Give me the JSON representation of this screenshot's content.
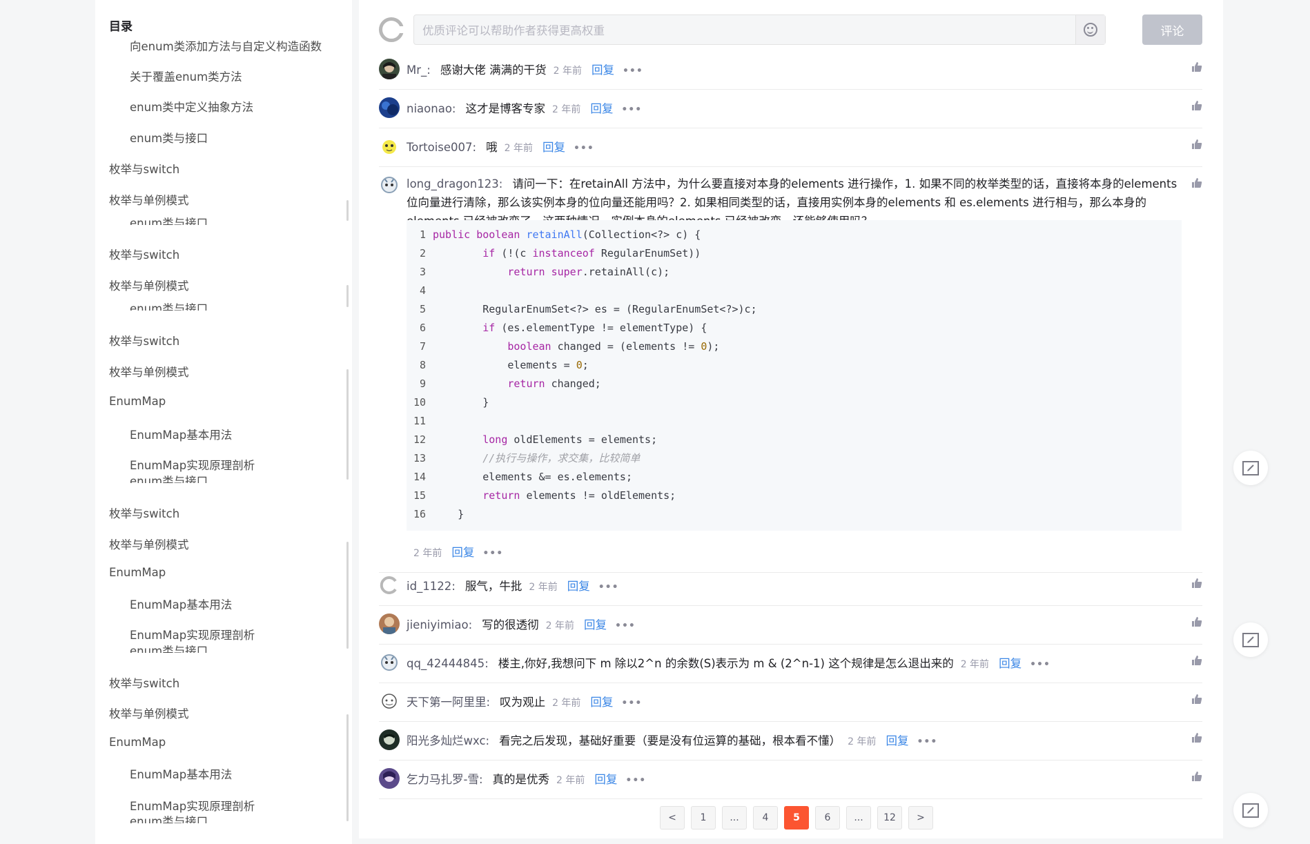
{
  "toc": {
    "title": "目录",
    "items": [
      {
        "label": "向enum类添加方法与自定义构造函数",
        "level": 2
      },
      {
        "label": "关于覆盖enum类方法",
        "level": 2
      },
      {
        "label": "enum类中定义抽象方法",
        "level": 2
      },
      {
        "label": "enum类与接口",
        "level": 2
      },
      {
        "label": "枚举与switch",
        "level": 1
      },
      {
        "label": "枚举与单例模式",
        "level": 1
      },
      {
        "label": "enum类与接口",
        "level": 2
      },
      {
        "label": "枚举与switch",
        "level": 1
      },
      {
        "label": "枚举与单例模式",
        "level": 1
      },
      {
        "label": "enum类与接口",
        "level": 2
      },
      {
        "label": "枚举与switch",
        "level": 1
      },
      {
        "label": "枚举与单例模式",
        "level": 1
      },
      {
        "label": "EnumMap",
        "level": 1
      },
      {
        "label": "EnumMap基本用法",
        "level": 2
      },
      {
        "label": "EnumMap实现原理剖析",
        "level": 2
      },
      {
        "label": "enum类与接口",
        "level": 2
      },
      {
        "label": "枚举与switch",
        "level": 1
      },
      {
        "label": "枚举与单例模式",
        "level": 1
      },
      {
        "label": "EnumMap",
        "level": 1
      },
      {
        "label": "EnumMap基本用法",
        "level": 2
      },
      {
        "label": "EnumMap实现原理剖析",
        "level": 2
      },
      {
        "label": "enum类与接口",
        "level": 2
      },
      {
        "label": "枚举与switch",
        "level": 1
      },
      {
        "label": "枚举与单例模式",
        "level": 1
      },
      {
        "label": "EnumMap",
        "level": 1
      },
      {
        "label": "EnumMap基本用法",
        "level": 2
      },
      {
        "label": "EnumMap实现原理剖析",
        "level": 2
      },
      {
        "label": "enum类与接口",
        "level": 2
      }
    ]
  },
  "comment_box": {
    "placeholder": "优质评论可以帮助作者获得更高权重",
    "submit_label": "评论"
  },
  "common": {
    "time": "2 年前",
    "reply": "回复",
    "more": "•••"
  },
  "comments": [
    {
      "user": "Mr_",
      "text": "感谢大佬 满满的干货",
      "avatar": "dark"
    },
    {
      "user": "niaonao",
      "text": "这才是博客专家",
      "avatar": "blue"
    },
    {
      "user": "Tortoise007",
      "text": "哦",
      "avatar": "yellow"
    },
    {
      "user": "long_dragon123",
      "text": "请问一下：在retainAll 方法中，为什么要直接对本身的elements 进行操作，1. 如果不同的枚举类型的话，直接将本身的elements 位向量进行清除，那么该实例本身的位向量还能用吗？2. 如果相同类型的话，直接用实例本身的elements 和 es.elements 进行相与，那么本身的elements 已经被改变了。这两种情况，实例本身的elements 已经被改变，还能够使用吗？",
      "avatar": "cartoon"
    },
    {
      "user": "id_1122",
      "text": "服气，牛批",
      "avatar": "logo"
    },
    {
      "user": "jieniyimiao",
      "text": "写的很透彻",
      "avatar": "brown"
    },
    {
      "user": "qq_42444845",
      "text": "楼主,你好,我想问下 m 除以2^n 的余数(S)表示为 m & (2^n-1) 这个规律是怎么退出来的",
      "avatar": "cartoon"
    },
    {
      "user": "天下第一阿里里",
      "text": "叹为观止",
      "avatar": "sketch"
    },
    {
      "user": "阳光多灿烂wxc",
      "text": "看完之后发现，基础好重要（要是没有位运算的基础，根本看不懂）",
      "avatar": "green"
    },
    {
      "user": "乞力马扎罗-雪",
      "text": "真的是优秀",
      "avatar": "purple"
    }
  ],
  "code": {
    "line_numbers": [
      "1",
      "2",
      "3",
      "4",
      "5",
      "6",
      "7",
      "8",
      "9",
      "10",
      "11",
      "12",
      "13",
      "14",
      "15",
      "16"
    ],
    "lines": [
      [
        [
          "kw",
          "public"
        ],
        [
          "tx",
          " "
        ],
        [
          "kw",
          "boolean"
        ],
        [
          "tx",
          " "
        ],
        [
          "fn",
          "retainAll"
        ],
        [
          "tx",
          "(Collection&lt;?&gt; c) {"
        ]
      ],
      [
        [
          "tx",
          "        "
        ],
        [
          "kw",
          "if"
        ],
        [
          "tx",
          " (!(c "
        ],
        [
          "kw",
          "instanceof"
        ],
        [
          "tx",
          " RegularEnumSet))"
        ]
      ],
      [
        [
          "tx",
          "            "
        ],
        [
          "kw",
          "return"
        ],
        [
          "tx",
          " "
        ],
        [
          "kw",
          "super"
        ],
        [
          "tx",
          ".retainAll(c);"
        ]
      ],
      [],
      [
        [
          "tx",
          "        RegularEnumSet&lt;?&gt; es = (RegularEnumSet&lt;?&gt;)c;"
        ]
      ],
      [
        [
          "tx",
          "        "
        ],
        [
          "kw",
          "if"
        ],
        [
          "tx",
          " (es.elementType != elementType) {"
        ]
      ],
      [
        [
          "tx",
          "            "
        ],
        [
          "kw",
          "boolean"
        ],
        [
          "tx",
          " changed = (elements != "
        ],
        [
          "num",
          "0"
        ],
        [
          "tx",
          ");"
        ]
      ],
      [
        [
          "tx",
          "            elements = "
        ],
        [
          "num",
          "0"
        ],
        [
          "tx",
          ";"
        ]
      ],
      [
        [
          "tx",
          "            "
        ],
        [
          "kw",
          "return"
        ],
        [
          "tx",
          " changed;"
        ]
      ],
      [
        [
          "tx",
          "        }"
        ]
      ],
      [],
      [
        [
          "tx",
          "        "
        ],
        [
          "kw",
          "long"
        ],
        [
          "tx",
          " oldElements = elements;"
        ]
      ],
      [
        [
          "tx",
          "        "
        ],
        [
          "cm",
          "//执行与操作，求交集，比较简单"
        ]
      ],
      [
        [
          "tx",
          "        elements &= es.elements;"
        ]
      ],
      [
        [
          "tx",
          "        "
        ],
        [
          "kw",
          "return"
        ],
        [
          "tx",
          " elements != oldElements;"
        ]
      ],
      [
        [
          "tx",
          "    }"
        ]
      ]
    ]
  },
  "pagination": {
    "items": [
      "<",
      "1",
      "...",
      "4",
      "5",
      "6",
      "...",
      "12",
      ">"
    ],
    "active": "5"
  },
  "colors": {
    "accent": "#fc5531",
    "link": "#3a86e6",
    "submit_disabled": "#c0c3cc"
  }
}
